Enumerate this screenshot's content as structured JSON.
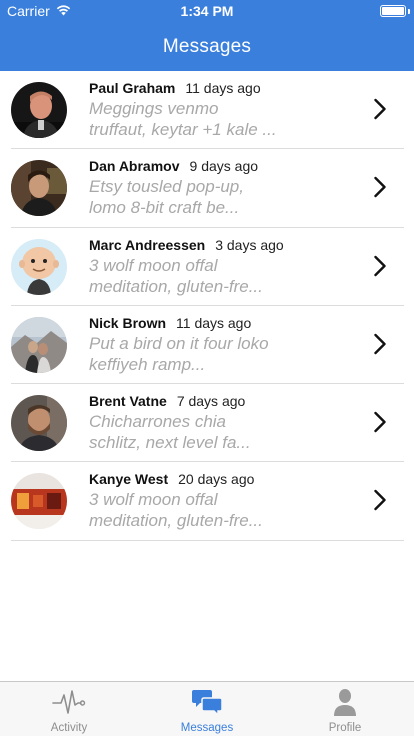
{
  "status_bar": {
    "carrier": "Carrier",
    "time": "1:34 PM"
  },
  "nav": {
    "title": "Messages"
  },
  "colors": {
    "accent": "#3a7fdc",
    "muted_text": "#a8a8a8",
    "tab_inactive": "#8e8e8e"
  },
  "messages": [
    {
      "name": "Paul Graham",
      "date": "11 days ago",
      "preview_line1": "Meggings venmo",
      "preview_line2": "truffaut, keytar +1 kale ..."
    },
    {
      "name": "Dan Abramov",
      "date": "9 days ago",
      "preview_line1": "Etsy tousled pop-up,",
      "preview_line2": "lomo 8-bit craft be..."
    },
    {
      "name": "Marc Andreessen",
      "date": "3 days ago",
      "preview_line1": "3 wolf moon offal",
      "preview_line2": "meditation, gluten-fre..."
    },
    {
      "name": "Nick Brown",
      "date": "11 days ago",
      "preview_line1": "Put a bird on it four loko",
      "preview_line2": "keffiyeh ramp..."
    },
    {
      "name": "Brent Vatne",
      "date": "7 days ago",
      "preview_line1": "Chicharrones chia",
      "preview_line2": "schlitz, next level fa..."
    },
    {
      "name": "Kanye West",
      "date": "20 days ago",
      "preview_line1": "3 wolf moon offal",
      "preview_line2": "meditation, gluten-fre..."
    }
  ],
  "tabs": [
    {
      "label": "Activity",
      "icon": "activity-pulse-icon",
      "active": false
    },
    {
      "label": "Messages",
      "icon": "chat-bubbles-icon",
      "active": true
    },
    {
      "label": "Profile",
      "icon": "person-icon",
      "active": false
    }
  ]
}
